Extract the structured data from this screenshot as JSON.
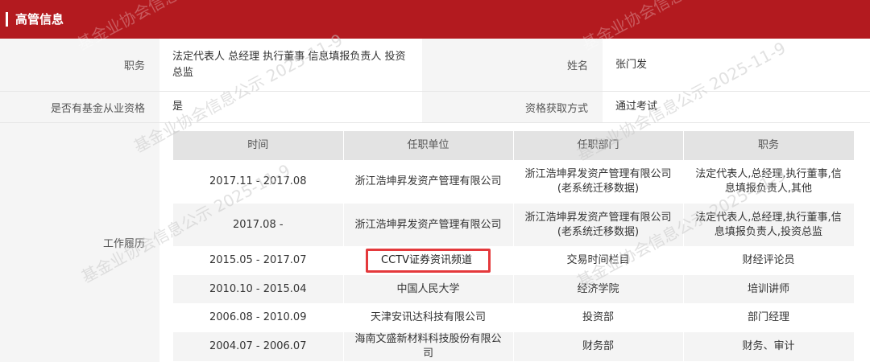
{
  "header": {
    "title": "高管信息"
  },
  "info": {
    "position_label": "职务",
    "position_value": "法定代表人 总经理 执行董事 信息填报负责人 投资总监",
    "name_label": "姓名",
    "name_value": "张门发",
    "qualification_label": "是否有基金从业资格",
    "qualification_value": "是",
    "acquire_label": "资格获取方式",
    "acquire_value": "通过考试"
  },
  "work_history": {
    "label": "工作履历",
    "columns": [
      "时间",
      "任职单位",
      "任职部门",
      "职务"
    ],
    "rows": [
      {
        "time": "2017.11 - 2017.08",
        "unit": "浙江浩坤昇发资产管理有限公司",
        "dept": "浙江浩坤昇发资产管理有限公司(老系统迁移数据)",
        "role": "法定代表人,总经理,执行董事,信息填报负责人,其他"
      },
      {
        "time": "2017.08 -",
        "unit": "浙江浩坤昇发资产管理有限公司",
        "dept": "浙江浩坤昇发资产管理有限公司(老系统迁移数据)",
        "role": "法定代表人,总经理,执行董事,信息填报负责人,投资总监"
      },
      {
        "time": "2015.05 - 2017.07",
        "unit": "CCTV证券资讯频道",
        "dept": "交易时间栏目",
        "role": "财经评论员"
      },
      {
        "time": "2010.10 - 2015.04",
        "unit": "中国人民大学",
        "dept": "经济学院",
        "role": "培训讲师"
      },
      {
        "time": "2006.08 - 2010.09",
        "unit": "天津安讯达科技有限公司",
        "dept": "投资部",
        "role": "部门经理"
      },
      {
        "time": "2004.07 - 2006.07",
        "unit": "海南文盛新材料科技股份有限公司",
        "dept": "财务部",
        "role": "财务、审计"
      }
    ]
  },
  "watermark": {
    "text": "基金业协会信息公示 2025-11-9",
    "short": "基金业协会信息"
  },
  "colors": {
    "header_bg": "#b31a1f",
    "highlight_border": "#e4393c"
  }
}
